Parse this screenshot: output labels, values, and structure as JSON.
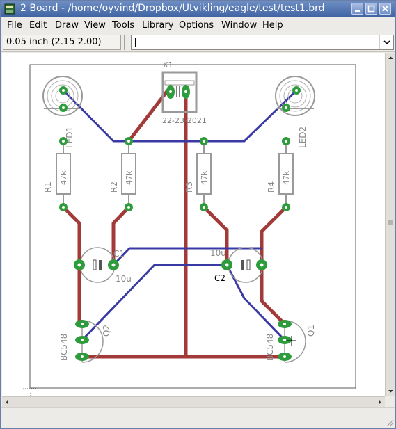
{
  "window": {
    "title": "2 Board - /home/oyvind/Dropbox/Utvikling/eagle/test/test1.brd"
  },
  "menubar": {
    "items": [
      {
        "label": "File",
        "accel": "F"
      },
      {
        "label": "Edit",
        "accel": "E"
      },
      {
        "label": "Draw",
        "accel": "D"
      },
      {
        "label": "View",
        "accel": "V"
      },
      {
        "label": "Tools",
        "accel": "T"
      },
      {
        "label": "Library",
        "accel": "L"
      },
      {
        "label": "Options",
        "accel": "O"
      },
      {
        "label": "Window",
        "accel": "W"
      },
      {
        "label": "Help",
        "accel": "H"
      }
    ]
  },
  "toolbar": {
    "coordinates": "0.05 inch (2.15 2.00)",
    "command_value": ""
  },
  "board": {
    "labels": {
      "x1": "X1",
      "x1_value": "22-23-2021",
      "led1": "LED1",
      "led2": "LED2",
      "r1": "R1",
      "r2": "R2",
      "r3": "R3",
      "r4": "R4",
      "r1_value": "47k",
      "r2_value": "47k",
      "r3_value": "47k",
      "r4_value": "47k",
      "c1": "C1",
      "c2": "C2",
      "c1_value": "10u",
      "c2_value": "10u",
      "q1": "Q1",
      "q2": "Q2",
      "q1_value": "BC548",
      "q2_value": "BC548"
    },
    "colors": {
      "top_trace": "#3a3aa4",
      "bottom_trace": "#a33a3a",
      "pad": "#2e9c3c",
      "outline": "#9a9a9a",
      "dimension": "#5a5a5a"
    }
  }
}
